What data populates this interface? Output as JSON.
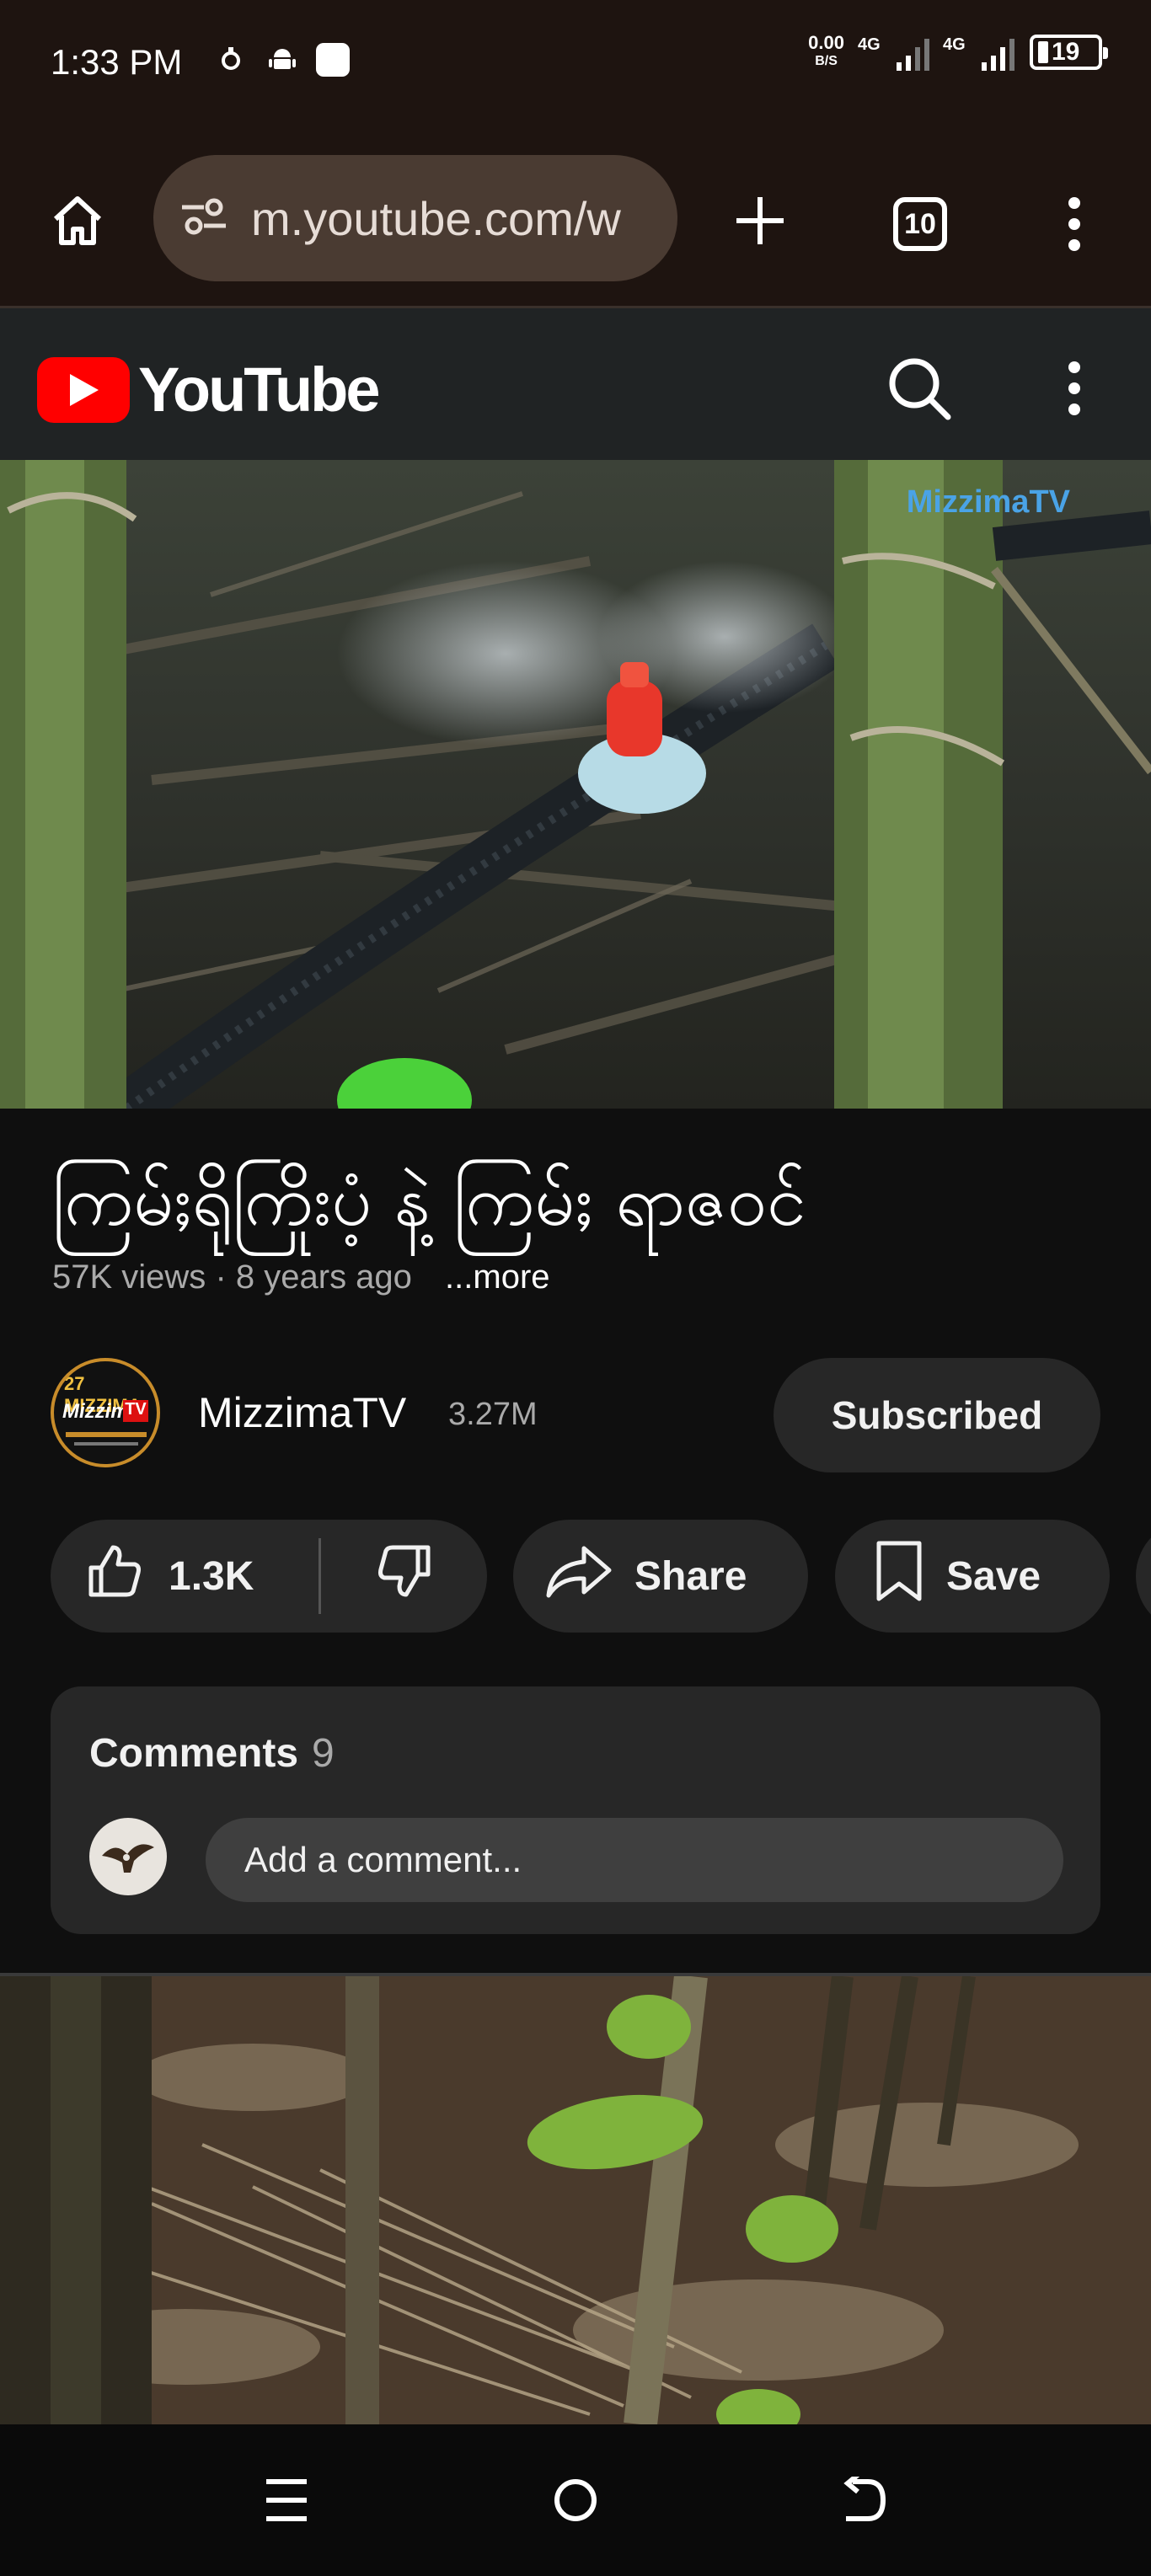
{
  "status_bar": {
    "time": "1:33 PM",
    "net_speed_value": "0.00",
    "net_speed_unit": "B/S",
    "network_1": "4G",
    "network_2": "4G",
    "battery": "19"
  },
  "browser": {
    "url": "m.youtube.com/w",
    "tab_count": "10"
  },
  "youtube": {
    "logo_text": "YouTube"
  },
  "video": {
    "watermark": "MizzimaTV",
    "title": "ကြမ်ႈရိုကြိုးပံ့ နဲ့ ကြမ်ႈ ရာဇဝင်",
    "views": "57K views",
    "separator": "·",
    "age": "8 years ago",
    "more_label": "...more"
  },
  "channel": {
    "name": "MizzimaTV",
    "subscribers": "3.27M",
    "subscribe_label": "Subscribed",
    "avatar_line1": "27 MIZZIMA",
    "avatar_line2": "Mizzima",
    "avatar_badge": "TV"
  },
  "actions": {
    "likes": "1.3K",
    "share_label": "Share",
    "save_label": "Save"
  },
  "comments": {
    "heading": "Comments",
    "count": "9",
    "placeholder": "Add a comment..."
  },
  "colors": {
    "accent_red": "#ff0000",
    "background": "#0f0f0f",
    "surface": "#272727",
    "browser_chrome": "#1e1410"
  }
}
